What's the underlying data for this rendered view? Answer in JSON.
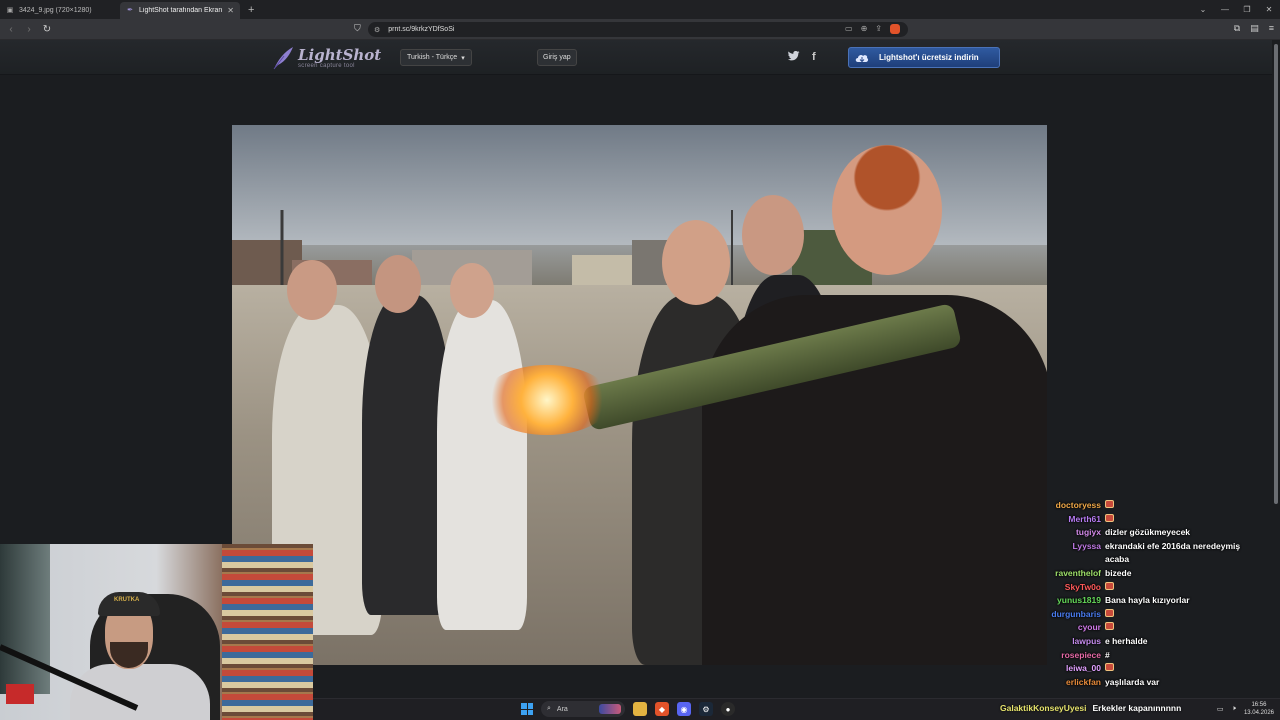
{
  "browser": {
    "tabs": [
      {
        "title": "3424_9.jpg (720×1280)",
        "active": false
      },
      {
        "title": "LightShot tarafından Ekran Görü",
        "active": true
      }
    ],
    "url": "prnt.sc/9krkzYDfSoSi"
  },
  "site": {
    "brand": "LightShot",
    "tagline": "screen capture tool",
    "language": "Turkish - Türkçe",
    "login_label": "Giriş yap",
    "twitter_icon": "twitter-icon",
    "facebook_icon": "facebook-icon",
    "download_label": "Lightshot'ı ücretsiz indirin",
    "accent": "#2f5aa0"
  },
  "webcam": {
    "cap_text": "KRUTKA"
  },
  "chat": [
    {
      "user": "doctoryess",
      "color": "#f0a848",
      "msg": "",
      "emote": true
    },
    {
      "user": "Merth61",
      "color": "#b67bf2",
      "msg": "",
      "emote": true
    },
    {
      "user": "tugiyx",
      "color": "#d28ae8",
      "msg": "dizler gözükmeyecek",
      "emote": false
    },
    {
      "user": "Lyyssa",
      "color": "#c07ae6",
      "msg": "ekrandaki efe 2016da neredeymiş",
      "emote": false
    },
    {
      "user": "",
      "color": "#ffffff",
      "msg": "acaba",
      "emote": false
    },
    {
      "user": "raventhelof",
      "color": "#9ee06a",
      "msg": "bizede",
      "emote": false
    },
    {
      "user": "SkyTw0o",
      "color": "#ff5a5a",
      "msg": "",
      "emote": true
    },
    {
      "user": "yunus1819",
      "color": "#66d95a",
      "msg": "Bana hayla kızıyorlar",
      "emote": false
    },
    {
      "user": "durgunbaris",
      "color": "#4a7cf0",
      "msg": "",
      "emote": true
    },
    {
      "user": "cyour",
      "color": "#d07ae8",
      "msg": "",
      "emote": true
    },
    {
      "user": "lawpus",
      "color": "#c48bec",
      "msg": "e herhalde",
      "emote": false
    },
    {
      "user": "rosepiece",
      "color": "#e86aa8",
      "msg": "#",
      "emote": false
    },
    {
      "user": "leiwa_00",
      "color": "#e0a0ff",
      "msg": "",
      "emote": true
    },
    {
      "user": "erlickfan",
      "color": "#e68a3a",
      "msg": "yaşlılarda var",
      "emote": false
    }
  ],
  "lower_chat": {
    "user": "GalaktikKonseyUyesi",
    "msg": "Erkekler kapanınnnnn"
  },
  "taskbar": {
    "search_placeholder": "Ara",
    "time": "16:56",
    "date": "13.04.2026"
  }
}
